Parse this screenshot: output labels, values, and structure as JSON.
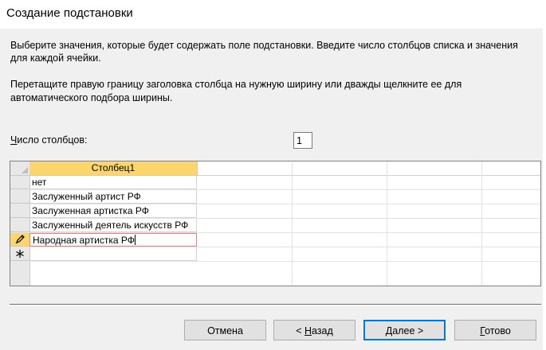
{
  "window": {
    "title": "Создание подстановки"
  },
  "instructions": {
    "line1": "Выберите значения, которые будет содержать поле подстановки. Введите число столбцов списка и значения",
    "line2": "для каждой ячейки.",
    "line3": "Перетащите правую границу заголовка столбца на нужную ширину или дважды щелкните ее для",
    "line4": "автоматического подбора ширины."
  },
  "column_count": {
    "label_hotkey": "Ч",
    "label_rest": "исло столбцов:",
    "value": "1"
  },
  "grid": {
    "column_header": "Столбец1",
    "rows": [
      "нет",
      "Заслуженный артист РФ",
      "Заслуженная артистка РФ",
      "Заслуженный деятель искусств РФ",
      "Народная артистка РФ"
    ],
    "edit_row_icon": "pencil-icon",
    "new_row_icon": "asterisk-icon"
  },
  "buttons": {
    "cancel": "Отмена",
    "back_prefix": "< ",
    "back_hotkey": "Н",
    "back_rest": "азад",
    "next_hotkey": "Д",
    "next_rest": "алее >",
    "finish_hotkey": "Г",
    "finish_rest": "отово"
  },
  "colors": {
    "accent": "#0078d7",
    "header_highlight": "#fcd66b",
    "active_row_border": "#e88080"
  }
}
